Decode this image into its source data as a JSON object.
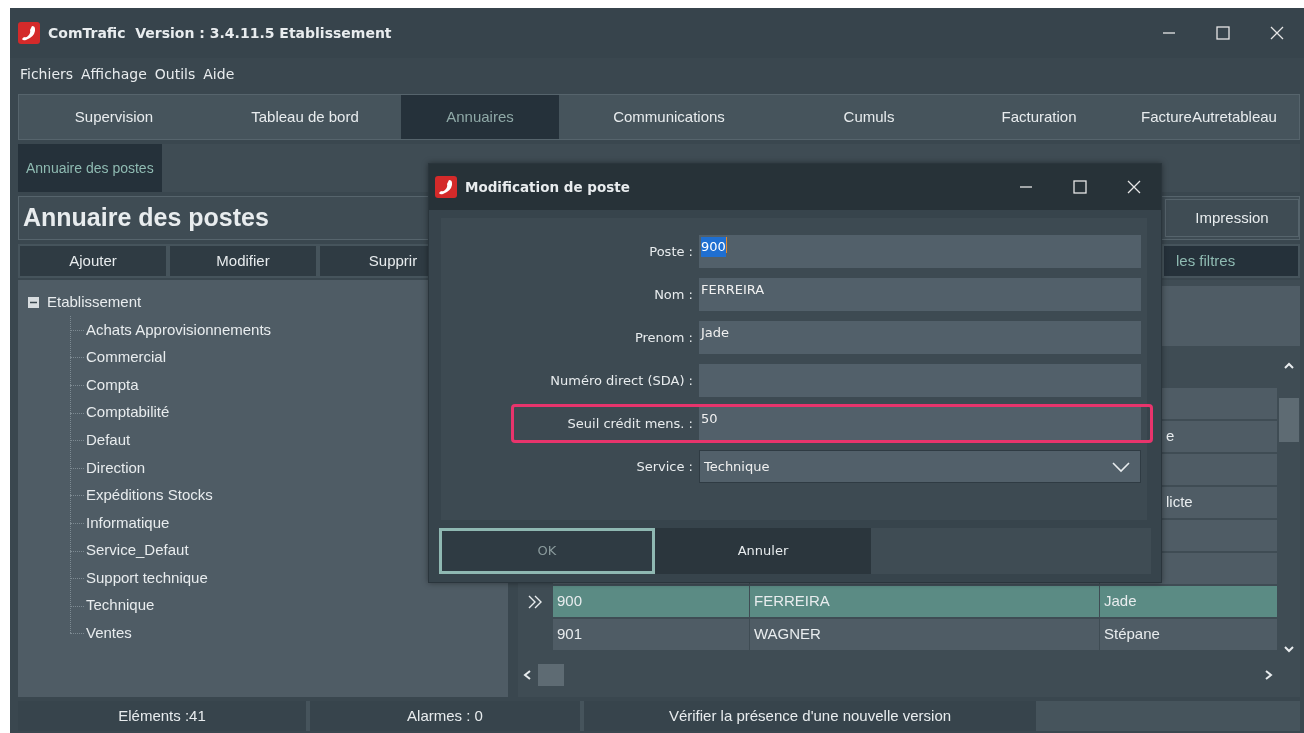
{
  "window": {
    "title": "ComTrafic  Version : 3.4.11.5 Etablissement"
  },
  "menu": [
    "Fichiers",
    "Affichage",
    "Outils",
    "Aide"
  ],
  "tabs": [
    {
      "label": "Supervision",
      "selected": false
    },
    {
      "label": "Tableau de bord",
      "selected": false
    },
    {
      "label": "Annuaires",
      "selected": true
    },
    {
      "label": "Communications",
      "selected": false
    },
    {
      "label": "Cumuls",
      "selected": false
    },
    {
      "label": "Facturation",
      "selected": false
    },
    {
      "label": "FactureAutretableau",
      "selected": false
    }
  ],
  "subtabs": [
    {
      "label": "Annuaire des postes",
      "selected": true
    }
  ],
  "page_title": "Annuaire des postes",
  "print_button": "Impression",
  "toolbar": [
    "Ajouter",
    "Modifier",
    "Supprir"
  ],
  "filter_button": "les filtres",
  "tree": {
    "label": "Etablissement",
    "expanded": true,
    "children": [
      {
        "label": "Achats Approvisionnements"
      },
      {
        "label": "Commercial"
      },
      {
        "label": "Compta"
      },
      {
        "label": "Comptabilité"
      },
      {
        "label": "Defaut"
      },
      {
        "label": "Direction"
      },
      {
        "label": "Expéditions Stocks"
      },
      {
        "label": "Informatique"
      },
      {
        "label": "Service_Defaut"
      },
      {
        "label": "Support technique"
      },
      {
        "label": "Technique"
      },
      {
        "label": "Ventes"
      }
    ]
  },
  "table": {
    "rows": [
      {
        "selected": false
      },
      {
        "selected": false,
        "prenom": "e"
      },
      {
        "selected": false
      },
      {
        "selected": false,
        "prenom": "licte"
      },
      {
        "selected": false
      },
      {
        "selected": false
      },
      {
        "selected": true,
        "poste": "900",
        "nom": "FERREIRA",
        "prenom": "Jade"
      },
      {
        "selected": false,
        "poste": "901",
        "nom": "WAGNER",
        "prenom": "Stépane"
      }
    ]
  },
  "dialog": {
    "title": "Modification de poste",
    "fields": [
      {
        "kind": "text",
        "label": "Poste :",
        "value": "900",
        "focused": true,
        "highlighted": false
      },
      {
        "kind": "text",
        "label": "Nom :",
        "value": "FERREIRA",
        "focused": false,
        "highlighted": false
      },
      {
        "kind": "text",
        "label": "Prenom :",
        "value": "Jade",
        "focused": false,
        "highlighted": false
      },
      {
        "kind": "text",
        "label": "Numéro direct (SDA) :",
        "focused": false,
        "highlighted": false
      },
      {
        "kind": "text",
        "label": "Seuil crédit mens. :",
        "value": "50",
        "focused": false,
        "highlighted": true
      },
      {
        "kind": "select",
        "label": "Service :",
        "value": "Technique",
        "focused": false,
        "highlighted": false
      }
    ],
    "buttons": [
      {
        "label": "OK",
        "default": true
      },
      {
        "label": "Annuler",
        "default": false
      }
    ]
  },
  "status_bar": [
    "Eléments :41",
    "Alarmes : 0",
    "Vérifier la présence d'une nouvelle version"
  ]
}
